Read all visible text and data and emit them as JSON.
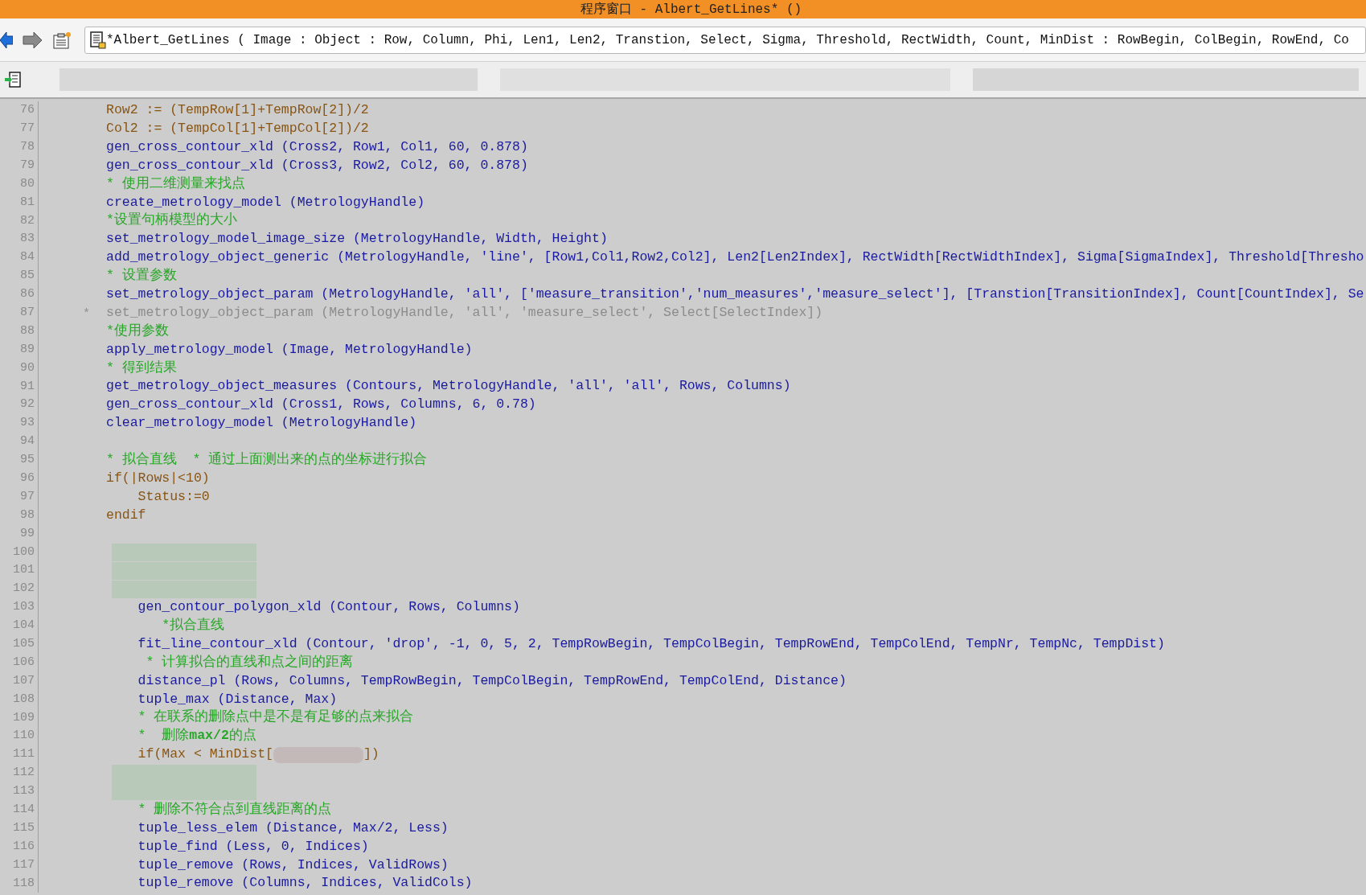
{
  "window": {
    "title": "程序窗口 - Albert_GetLines* ()"
  },
  "toolbar": {
    "signature": "*Albert_GetLines ( Image : Object : Row, Column, Phi, Len1, Len2, Transtion, Select, Sigma, Threshold, RectWidth, Count, MinDist : RowBegin, ColBegin, RowEnd, Co"
  },
  "lines": [
    {
      "num": "76",
      "kind": "assign",
      "text": "Row2 := (TempRow[1]+TempRow[2])/2"
    },
    {
      "num": "77",
      "kind": "assign",
      "text": "Col2 := (TempCol[1]+TempCol[2])/2"
    },
    {
      "num": "78",
      "kind": "call",
      "text": "gen_cross_contour_xld (Cross2, Row1, Col1, 60, 0.878)"
    },
    {
      "num": "79",
      "kind": "call",
      "text": "gen_cross_contour_xld (Cross3, Row2, Col2, 60, 0.878)"
    },
    {
      "num": "80",
      "kind": "comment",
      "text": "* 使用二维测量来找点"
    },
    {
      "num": "81",
      "kind": "call",
      "text": "create_metrology_model (MetrologyHandle)"
    },
    {
      "num": "82",
      "kind": "comment",
      "text": "*设置句柄模型的大小"
    },
    {
      "num": "83",
      "kind": "call",
      "text": "set_metrology_model_image_size (MetrologyHandle, Width, Height)"
    },
    {
      "num": "84",
      "kind": "call",
      "text": "add_metrology_object_generic (MetrologyHandle, 'line', [Row1,Col1,Row2,Col2], Len2[Len2Index], RectWidth[RectWidthIndex], Sigma[SigmaIndex], Threshold[Thresho"
    },
    {
      "num": "85",
      "kind": "comment",
      "text": "* 设置参数"
    },
    {
      "num": "86",
      "kind": "call",
      "text": "set_metrology_object_param (MetrologyHandle, 'all', ['measure_transition','num_measures','measure_select'], [Transtion[TransitionIndex], Count[CountIndex], Se"
    },
    {
      "num": "87",
      "kind": "disabled",
      "marker": "*",
      "text": "set_metrology_object_param (MetrologyHandle, 'all', 'measure_select', Select[SelectIndex])"
    },
    {
      "num": "88",
      "kind": "comment",
      "text": "*使用参数"
    },
    {
      "num": "89",
      "kind": "call",
      "text": "apply_metrology_model (Image, MetrologyHandle)"
    },
    {
      "num": "90",
      "kind": "comment",
      "text": "* 得到结果"
    },
    {
      "num": "91",
      "kind": "call",
      "text": "get_metrology_object_measures (Contours, MetrologyHandle, 'all', 'all', Rows, Columns)"
    },
    {
      "num": "92",
      "kind": "call",
      "text": "gen_cross_contour_xld (Cross1, Rows, Columns, 6, 0.78)"
    },
    {
      "num": "93",
      "kind": "call",
      "text": "clear_metrology_model (MetrologyHandle)"
    },
    {
      "num": "94",
      "kind": "blank"
    },
    {
      "num": "95",
      "kind": "comment",
      "text": "* 拟合直线  * 通过上面测出来的点的坐标进行拟合"
    },
    {
      "num": "96",
      "kind": "assign",
      "text": "if(|Rows|<10)"
    },
    {
      "num": "97",
      "kind": "assign",
      "text": "    Status:=0"
    },
    {
      "num": "98",
      "kind": "assign",
      "text": "endif"
    },
    {
      "num": "99",
      "kind": "blank"
    },
    {
      "num": "100",
      "kind": "redacted"
    },
    {
      "num": "101",
      "kind": "redacted"
    },
    {
      "num": "102",
      "kind": "redacted"
    },
    {
      "num": "103",
      "kind": "call",
      "text": "    gen_contour_polygon_xld (Contour, Rows, Columns)"
    },
    {
      "num": "104",
      "kind": "comment",
      "text": "       *拟合直线"
    },
    {
      "num": "105",
      "kind": "call",
      "text": "    fit_line_contour_xld (Contour, 'drop', -1, 0, 5, 2, TempRowBegin, TempColBegin, TempRowEnd, TempColEnd, TempNr, TempNc, TempDist)"
    },
    {
      "num": "106",
      "kind": "comment",
      "text": "     * 计算拟合的直线和点之间的距离"
    },
    {
      "num": "107",
      "kind": "call",
      "text": "    distance_pl (Rows, Columns, TempRowBegin, TempColBegin, TempRowEnd, TempColEnd, Distance)"
    },
    {
      "num": "108",
      "kind": "call",
      "text": "    tuple_max (Distance, Max)"
    },
    {
      "num": "109",
      "kind": "comment",
      "text": "    * 在联系的删除点中是不是有足够的点来拟合"
    },
    {
      "num": "110",
      "kind": "comment",
      "text": "    *  删除**max/2**的点"
    },
    {
      "num": "111",
      "kind": "partial",
      "parts": [
        "    if(Max < MinDist[",
        "])"
      ]
    },
    {
      "num": "112",
      "kind": "redacted"
    },
    {
      "num": "113",
      "kind": "redacted"
    },
    {
      "num": "114",
      "kind": "comment",
      "text": "    * 删除不符合点到直线距离的点"
    },
    {
      "num": "115",
      "kind": "call",
      "text": "    tuple_less_elem (Distance, Max/2, Less)"
    },
    {
      "num": "116",
      "kind": "call",
      "text": "    tuple_find (Less, 0, Indices)"
    },
    {
      "num": "117",
      "kind": "call",
      "text": "    tuple_remove (Rows, Indices, ValidRows)"
    },
    {
      "num": "118",
      "kind": "call",
      "text": "    tuple_remove (Columns, Indices, ValidCols)"
    }
  ]
}
